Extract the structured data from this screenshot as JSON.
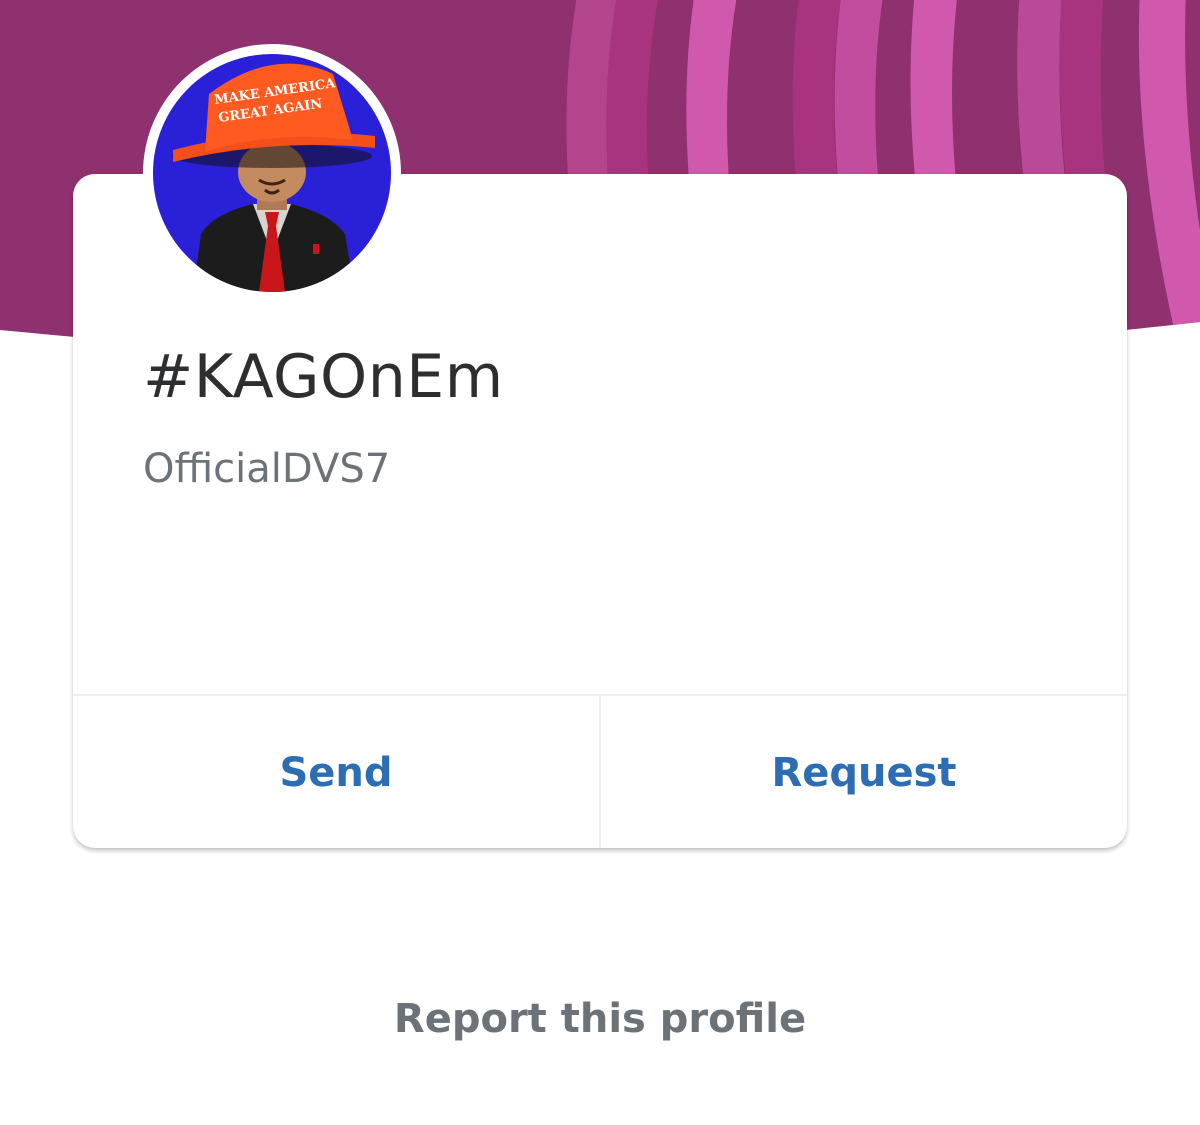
{
  "colors": {
    "banner_base": "#8f306f",
    "banner_stripe_dark": "#a8347f",
    "banner_stripe_light": "#d159ad",
    "name_text": "#2c2e2f",
    "secondary_text": "#6c7378",
    "action_link": "#2c6db3",
    "avatar_background": "#2a20d8",
    "hat": "#ff5a1f"
  },
  "avatar": {
    "hat_text_line1": "MAKE AMERICA",
    "hat_text_line2": "GREAT AGAIN"
  },
  "profile": {
    "display_name": "#KAGOnEm",
    "username": "OfficialDVS7"
  },
  "actions": {
    "send_label": "Send",
    "request_label": "Request"
  },
  "footer": {
    "report_label": "Report this profile"
  }
}
